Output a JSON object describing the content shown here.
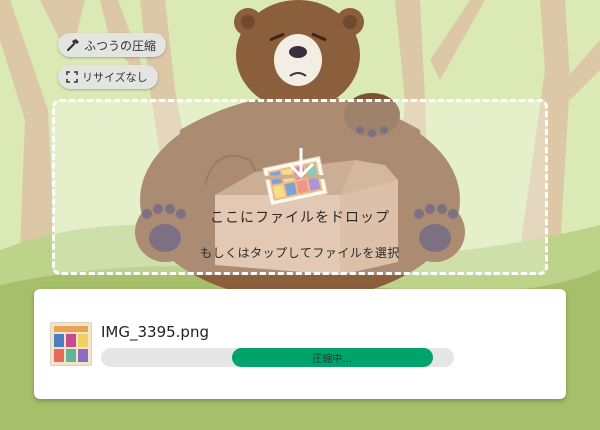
{
  "toolbar": {
    "mode_label": "ふつうの圧縮",
    "mode_icon": "hammer-icon",
    "resize_label": "リサイズなし",
    "resize_icon": "expand-corners-icon"
  },
  "dropzone": {
    "title": "ここにファイルをドロップ",
    "subtitle": "もしくはタップしてファイルを選択",
    "icon": "drop-arrow-icon"
  },
  "file": {
    "name": "IMG_3395.png",
    "status": "圧縮中…",
    "progress_start": 0.37,
    "progress_end": 0.94
  },
  "colors": {
    "progress": "#00a36c",
    "track": "#e6e6e6",
    "sky": "#dbe9b4",
    "ground": "#a6bf6a",
    "bear": "#8b5f3c"
  }
}
